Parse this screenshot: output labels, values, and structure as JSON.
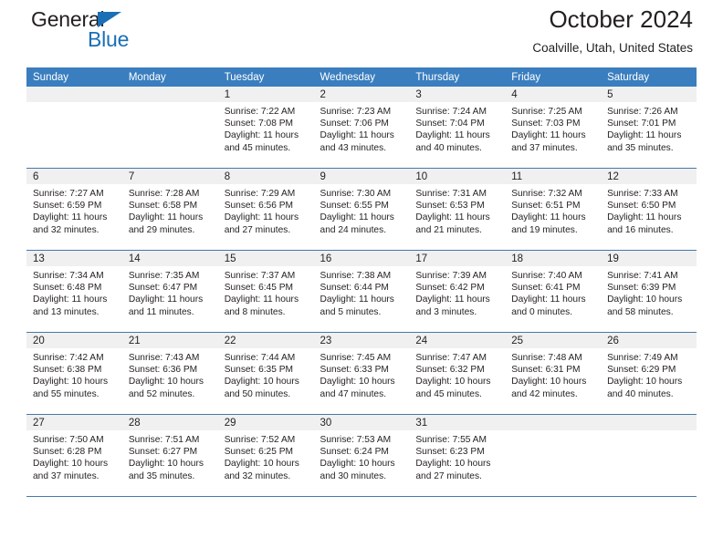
{
  "brand": {
    "name_part1": "General",
    "name_part2": "Blue",
    "accent_color": "#1a6fb5",
    "triangle_icon": "triangle-icon"
  },
  "header": {
    "title": "October 2024",
    "subtitle": "Coalville, Utah, United States"
  },
  "colors": {
    "header_row_bg": "#3a7ebf",
    "header_row_text": "#ffffff",
    "daynum_band_bg": "#f0f0f0",
    "row_separator": "#4679a8",
    "text": "#231f20"
  },
  "weekday_headers": [
    "Sunday",
    "Monday",
    "Tuesday",
    "Wednesday",
    "Thursday",
    "Friday",
    "Saturday"
  ],
  "labels": {
    "sunrise_prefix": "Sunrise:",
    "sunset_prefix": "Sunset:",
    "daylight_prefix": "Daylight:"
  },
  "weeks": [
    [
      {
        "day": "",
        "blank": true
      },
      {
        "day": "",
        "blank": true
      },
      {
        "day": "1",
        "sunrise": "Sunrise: 7:22 AM",
        "sunset": "Sunset: 7:08 PM",
        "daylight": "Daylight: 11 hours and 45 minutes."
      },
      {
        "day": "2",
        "sunrise": "Sunrise: 7:23 AM",
        "sunset": "Sunset: 7:06 PM",
        "daylight": "Daylight: 11 hours and 43 minutes."
      },
      {
        "day": "3",
        "sunrise": "Sunrise: 7:24 AM",
        "sunset": "Sunset: 7:04 PM",
        "daylight": "Daylight: 11 hours and 40 minutes."
      },
      {
        "day": "4",
        "sunrise": "Sunrise: 7:25 AM",
        "sunset": "Sunset: 7:03 PM",
        "daylight": "Daylight: 11 hours and 37 minutes."
      },
      {
        "day": "5",
        "sunrise": "Sunrise: 7:26 AM",
        "sunset": "Sunset: 7:01 PM",
        "daylight": "Daylight: 11 hours and 35 minutes."
      }
    ],
    [
      {
        "day": "6",
        "sunrise": "Sunrise: 7:27 AM",
        "sunset": "Sunset: 6:59 PM",
        "daylight": "Daylight: 11 hours and 32 minutes."
      },
      {
        "day": "7",
        "sunrise": "Sunrise: 7:28 AM",
        "sunset": "Sunset: 6:58 PM",
        "daylight": "Daylight: 11 hours and 29 minutes."
      },
      {
        "day": "8",
        "sunrise": "Sunrise: 7:29 AM",
        "sunset": "Sunset: 6:56 PM",
        "daylight": "Daylight: 11 hours and 27 minutes."
      },
      {
        "day": "9",
        "sunrise": "Sunrise: 7:30 AM",
        "sunset": "Sunset: 6:55 PM",
        "daylight": "Daylight: 11 hours and 24 minutes."
      },
      {
        "day": "10",
        "sunrise": "Sunrise: 7:31 AM",
        "sunset": "Sunset: 6:53 PM",
        "daylight": "Daylight: 11 hours and 21 minutes."
      },
      {
        "day": "11",
        "sunrise": "Sunrise: 7:32 AM",
        "sunset": "Sunset: 6:51 PM",
        "daylight": "Daylight: 11 hours and 19 minutes."
      },
      {
        "day": "12",
        "sunrise": "Sunrise: 7:33 AM",
        "sunset": "Sunset: 6:50 PM",
        "daylight": "Daylight: 11 hours and 16 minutes."
      }
    ],
    [
      {
        "day": "13",
        "sunrise": "Sunrise: 7:34 AM",
        "sunset": "Sunset: 6:48 PM",
        "daylight": "Daylight: 11 hours and 13 minutes."
      },
      {
        "day": "14",
        "sunrise": "Sunrise: 7:35 AM",
        "sunset": "Sunset: 6:47 PM",
        "daylight": "Daylight: 11 hours and 11 minutes."
      },
      {
        "day": "15",
        "sunrise": "Sunrise: 7:37 AM",
        "sunset": "Sunset: 6:45 PM",
        "daylight": "Daylight: 11 hours and 8 minutes."
      },
      {
        "day": "16",
        "sunrise": "Sunrise: 7:38 AM",
        "sunset": "Sunset: 6:44 PM",
        "daylight": "Daylight: 11 hours and 5 minutes."
      },
      {
        "day": "17",
        "sunrise": "Sunrise: 7:39 AM",
        "sunset": "Sunset: 6:42 PM",
        "daylight": "Daylight: 11 hours and 3 minutes."
      },
      {
        "day": "18",
        "sunrise": "Sunrise: 7:40 AM",
        "sunset": "Sunset: 6:41 PM",
        "daylight": "Daylight: 11 hours and 0 minutes."
      },
      {
        "day": "19",
        "sunrise": "Sunrise: 7:41 AM",
        "sunset": "Sunset: 6:39 PM",
        "daylight": "Daylight: 10 hours and 58 minutes."
      }
    ],
    [
      {
        "day": "20",
        "sunrise": "Sunrise: 7:42 AM",
        "sunset": "Sunset: 6:38 PM",
        "daylight": "Daylight: 10 hours and 55 minutes."
      },
      {
        "day": "21",
        "sunrise": "Sunrise: 7:43 AM",
        "sunset": "Sunset: 6:36 PM",
        "daylight": "Daylight: 10 hours and 52 minutes."
      },
      {
        "day": "22",
        "sunrise": "Sunrise: 7:44 AM",
        "sunset": "Sunset: 6:35 PM",
        "daylight": "Daylight: 10 hours and 50 minutes."
      },
      {
        "day": "23",
        "sunrise": "Sunrise: 7:45 AM",
        "sunset": "Sunset: 6:33 PM",
        "daylight": "Daylight: 10 hours and 47 minutes."
      },
      {
        "day": "24",
        "sunrise": "Sunrise: 7:47 AM",
        "sunset": "Sunset: 6:32 PM",
        "daylight": "Daylight: 10 hours and 45 minutes."
      },
      {
        "day": "25",
        "sunrise": "Sunrise: 7:48 AM",
        "sunset": "Sunset: 6:31 PM",
        "daylight": "Daylight: 10 hours and 42 minutes."
      },
      {
        "day": "26",
        "sunrise": "Sunrise: 7:49 AM",
        "sunset": "Sunset: 6:29 PM",
        "daylight": "Daylight: 10 hours and 40 minutes."
      }
    ],
    [
      {
        "day": "27",
        "sunrise": "Sunrise: 7:50 AM",
        "sunset": "Sunset: 6:28 PM",
        "daylight": "Daylight: 10 hours and 37 minutes."
      },
      {
        "day": "28",
        "sunrise": "Sunrise: 7:51 AM",
        "sunset": "Sunset: 6:27 PM",
        "daylight": "Daylight: 10 hours and 35 minutes."
      },
      {
        "day": "29",
        "sunrise": "Sunrise: 7:52 AM",
        "sunset": "Sunset: 6:25 PM",
        "daylight": "Daylight: 10 hours and 32 minutes."
      },
      {
        "day": "30",
        "sunrise": "Sunrise: 7:53 AM",
        "sunset": "Sunset: 6:24 PM",
        "daylight": "Daylight: 10 hours and 30 minutes."
      },
      {
        "day": "31",
        "sunrise": "Sunrise: 7:55 AM",
        "sunset": "Sunset: 6:23 PM",
        "daylight": "Daylight: 10 hours and 27 minutes."
      },
      {
        "day": "",
        "blank": true
      },
      {
        "day": "",
        "blank": true
      }
    ]
  ]
}
